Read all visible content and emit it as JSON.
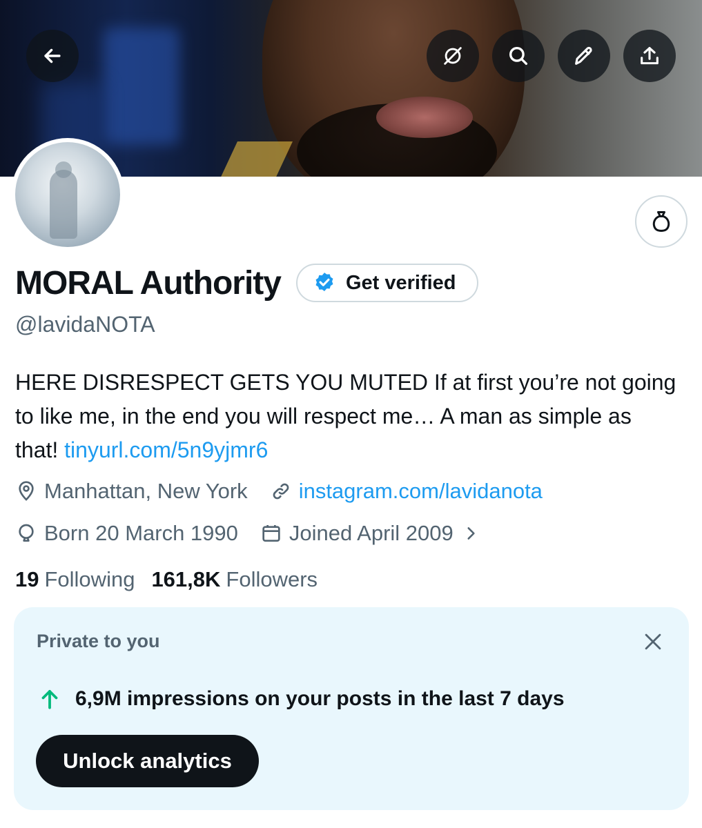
{
  "header": {
    "buttons": [
      {
        "id": "back",
        "icon": "arrow-left-icon"
      },
      {
        "id": "grok",
        "icon": "grok-icon"
      },
      {
        "id": "search",
        "icon": "search-icon"
      },
      {
        "id": "edit",
        "icon": "pencil-icon"
      },
      {
        "id": "share",
        "icon": "share-upload-icon"
      }
    ]
  },
  "profile": {
    "display_name": "MORAL Authority",
    "verify_label": "Get verified",
    "handle": "@lavidaNOTA",
    "bio_text": "HERE DISRESPECT GETS YOU MUTED If at first you’re not going to like me, in the end you will respect me… A man as simple as that! ",
    "bio_link": "tinyurl.com/5n9yjmr6",
    "location": "Manhattan, New York",
    "website": "instagram.com/lavidanota",
    "born": "Born 20 March 1990",
    "joined": "Joined April 2009",
    "following_count": "19",
    "following_label": "Following",
    "followers_count": "161,8K",
    "followers_label": "Followers"
  },
  "private_card": {
    "title": "Private to you",
    "impressions_text": "6,9M impressions on your posts in the last 7 days",
    "button_label": "Unlock analytics"
  },
  "colors": {
    "accent": "#1d9bf0",
    "text_primary": "#0f1419",
    "text_secondary": "#536471",
    "card_bg": "#e9f7fd",
    "trend_up": "#00ba7c"
  }
}
